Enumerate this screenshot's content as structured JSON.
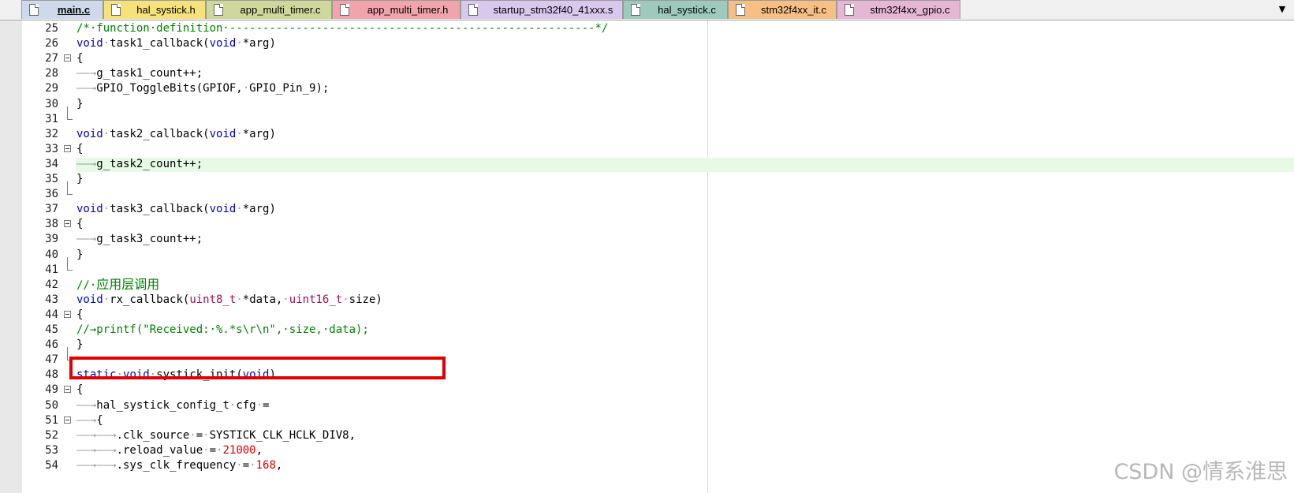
{
  "tabs": [
    {
      "label": "main.c",
      "color": "#cfd9ec",
      "active": true
    },
    {
      "label": "hal_systick.h",
      "color": "#f6e27a",
      "active": false
    },
    {
      "label": "app_multi_timer.c",
      "color": "#cfd79a",
      "active": false
    },
    {
      "label": "app_multi_timer.h",
      "color": "#f2a4ad",
      "active": false
    },
    {
      "label": "startup_stm32f40_41xxx.s",
      "color": "#d8c8ee",
      "active": false
    },
    {
      "label": "hal_systick.c",
      "color": "#9ec9bd",
      "active": false
    },
    {
      "label": "stm32f4xx_it.c",
      "color": "#f8bf84",
      "active": false
    },
    {
      "label": "stm32f4xx_gpio.c",
      "color": "#e6b7d4",
      "active": false
    }
  ],
  "tab_menu_icon": "chevron-down-icon",
  "editor": {
    "highlighted_line": 34,
    "lines": [
      {
        "num": "25",
        "fold": "",
        "tokens": [
          [
            "cm",
            "/*·function·definition·-------------------------------------------------------*/"
          ]
        ]
      },
      {
        "num": "26",
        "fold": "",
        "tokens": [
          [
            "kw",
            "void"
          ],
          [
            "ws",
            "·"
          ],
          [
            "t",
            "task1_callback("
          ],
          [
            "kw",
            "void"
          ],
          [
            "ws",
            "·"
          ],
          [
            "t",
            "*arg)"
          ]
        ]
      },
      {
        "num": "27",
        "fold": "open",
        "tokens": [
          [
            "t",
            "{"
          ]
        ]
      },
      {
        "num": "28",
        "fold": "",
        "tokens": [
          [
            "ws",
            "——→"
          ],
          [
            "t",
            "g_task1_count++;"
          ]
        ]
      },
      {
        "num": "29",
        "fold": "",
        "tokens": [
          [
            "ws",
            "——→"
          ],
          [
            "t",
            "GPIO_ToggleBits(GPIOF,"
          ],
          [
            "ws",
            "·"
          ],
          [
            "t",
            "GPIO_Pin_9);"
          ]
        ]
      },
      {
        "num": "30",
        "fold": "",
        "tokens": [
          [
            "t",
            "}"
          ]
        ]
      },
      {
        "num": "31",
        "fold": "end",
        "tokens": []
      },
      {
        "num": "32",
        "fold": "",
        "tokens": [
          [
            "kw",
            "void"
          ],
          [
            "ws",
            "·"
          ],
          [
            "t",
            "task2_callback("
          ],
          [
            "kw",
            "void"
          ],
          [
            "ws",
            "·"
          ],
          [
            "t",
            "*arg)"
          ]
        ]
      },
      {
        "num": "33",
        "fold": "open",
        "tokens": [
          [
            "t",
            "{"
          ]
        ]
      },
      {
        "num": "34",
        "fold": "",
        "tokens": [
          [
            "ws",
            "——→"
          ],
          [
            "t",
            "g_task2_count++;"
          ]
        ]
      },
      {
        "num": "35",
        "fold": "",
        "tokens": [
          [
            "t",
            "}"
          ]
        ]
      },
      {
        "num": "36",
        "fold": "end",
        "tokens": []
      },
      {
        "num": "37",
        "fold": "",
        "tokens": [
          [
            "kw",
            "void"
          ],
          [
            "ws",
            "·"
          ],
          [
            "t",
            "task3_callback("
          ],
          [
            "kw",
            "void"
          ],
          [
            "ws",
            "·"
          ],
          [
            "t",
            "*arg)"
          ]
        ]
      },
      {
        "num": "38",
        "fold": "open",
        "tokens": [
          [
            "t",
            "{"
          ]
        ]
      },
      {
        "num": "39",
        "fold": "",
        "tokens": [
          [
            "ws",
            "——→"
          ],
          [
            "t",
            "g_task3_count++;"
          ]
        ]
      },
      {
        "num": "40",
        "fold": "",
        "tokens": [
          [
            "t",
            "}"
          ]
        ]
      },
      {
        "num": "41",
        "fold": "end",
        "tokens": []
      },
      {
        "num": "42",
        "fold": "",
        "tokens": [
          [
            "cm",
            "//·"
          ],
          [
            "cjk",
            "应用层调用"
          ]
        ]
      },
      {
        "num": "43",
        "fold": "",
        "tokens": [
          [
            "kw",
            "void"
          ],
          [
            "ws",
            "·"
          ],
          [
            "t",
            "rx_callback("
          ],
          [
            "type",
            "uint8_t"
          ],
          [
            "ws",
            "·"
          ],
          [
            "t",
            "*data,"
          ],
          [
            "ws",
            "·"
          ],
          [
            "type",
            "uint16_t"
          ],
          [
            "ws",
            "·"
          ],
          [
            "t",
            "size)"
          ]
        ]
      },
      {
        "num": "44",
        "fold": "open",
        "tokens": [
          [
            "t",
            "{"
          ]
        ]
      },
      {
        "num": "45",
        "fold": "",
        "tokens": [
          [
            "cm",
            "//→printf(\"Received:·%.*s\\r\\n\",·size,·data);"
          ]
        ]
      },
      {
        "num": "46",
        "fold": "",
        "tokens": [
          [
            "t",
            "}"
          ]
        ]
      },
      {
        "num": "47",
        "fold": "end",
        "tokens": []
      },
      {
        "num": "48",
        "fold": "",
        "tokens": [
          [
            "kw",
            "static"
          ],
          [
            "ws",
            "·"
          ],
          [
            "kw",
            "void"
          ],
          [
            "ws",
            "·"
          ],
          [
            "t",
            "systick_init("
          ],
          [
            "kw",
            "void"
          ],
          [
            "t",
            ")"
          ]
        ]
      },
      {
        "num": "49",
        "fold": "open",
        "tokens": [
          [
            "t",
            "{"
          ]
        ]
      },
      {
        "num": "50",
        "fold": "",
        "tokens": [
          [
            "ws",
            "——→"
          ],
          [
            "t",
            "hal_systick_config_t"
          ],
          [
            "ws",
            "·"
          ],
          [
            "t",
            "cfg"
          ],
          [
            "ws",
            "·"
          ],
          [
            "t",
            "="
          ]
        ]
      },
      {
        "num": "51",
        "fold": "open",
        "tokens": [
          [
            "ws",
            "——→"
          ],
          [
            "t",
            "{"
          ]
        ]
      },
      {
        "num": "52",
        "fold": "",
        "tokens": [
          [
            "ws",
            "——→——→"
          ],
          [
            "t",
            ".clk_source"
          ],
          [
            "ws",
            "·"
          ],
          [
            "t",
            "="
          ],
          [
            "ws",
            "·"
          ],
          [
            "t",
            "SYSTICK_CLK_HCLK_DIV8,"
          ]
        ]
      },
      {
        "num": "53",
        "fold": "",
        "tokens": [
          [
            "ws",
            "——→——→"
          ],
          [
            "t",
            ".reload_value"
          ],
          [
            "ws",
            "·"
          ],
          [
            "t",
            "="
          ],
          [
            "ws",
            "·"
          ],
          [
            "num",
            "21000"
          ],
          [
            "t",
            ","
          ]
        ]
      },
      {
        "num": "54",
        "fold": "",
        "tokens": [
          [
            "ws",
            "——→——→"
          ],
          [
            "t",
            ".sys_clk_frequency"
          ],
          [
            "ws",
            "·"
          ],
          [
            "t",
            "="
          ],
          [
            "ws",
            "·"
          ],
          [
            "num",
            "168"
          ],
          [
            "t",
            ","
          ]
        ]
      }
    ]
  },
  "watermark": "CSDN @情系淮思"
}
